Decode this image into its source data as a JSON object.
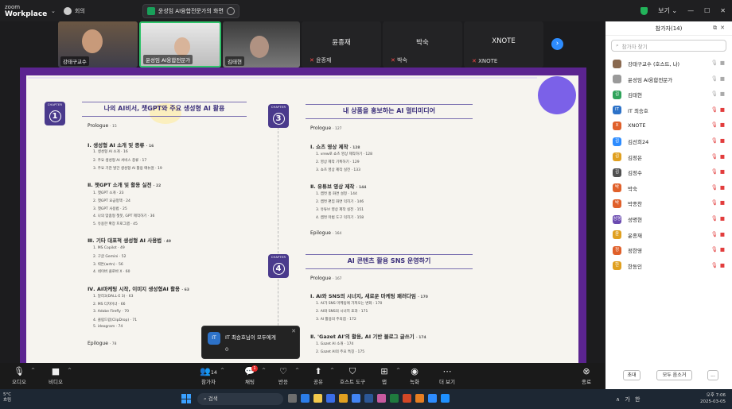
{
  "app": {
    "brand_top": "zoom",
    "brand_bottom": "Workplace",
    "meeting_label": "회의"
  },
  "sharing_banner": {
    "text": "윤성임 AI융합전문가의 화면"
  },
  "titlebar_right": {
    "view_label": "보기"
  },
  "video_strip": [
    {
      "name": "강태구교수"
    },
    {
      "name": "윤성임 AI융합전문가"
    },
    {
      "name": "김태현"
    },
    {
      "name": "윤종재",
      "label": "윤종재"
    },
    {
      "name": "박숙",
      "label": "박숙"
    },
    {
      "name": "XNOTE",
      "label": "XNOTE"
    }
  ],
  "document": {
    "chapters": [
      {
        "number": "1",
        "chapter_word": "CHAPTER",
        "title": "나의 AI비서, 챗GPT와 주요 생성형 AI 활용"
      },
      {
        "number": "3",
        "chapter_word": "CHAPTER",
        "title": "내 상품을 홍보하는 AI 멀티미디어"
      },
      {
        "number": "4",
        "chapter_word": "CHAPTER",
        "title": "AI 콘텐츠 활용 SNS 운영하기"
      }
    ],
    "left": {
      "prologue": "Prologue",
      "prologue_page": "· 15",
      "s1": "Ⅰ. 생성형 AI 소개 및 종류",
      "s1_page": "· 16",
      "s1_items": [
        "1. 생성형 AI 소개 · 16",
        "2. 주요 생성형 AI 서비스 종류 · 17",
        "3. 주요 기관 발간 생성형 AI 활용 매뉴얼 · 19"
      ],
      "s2": "Ⅱ. 챗GPT 소개 및 활용 실전",
      "s2_page": "· 22",
      "s2_items": [
        "1. 챗GPT 소개 · 23",
        "2. 챗GPT 요금정책 · 24",
        "3. 챗GPT 사용법 · 25",
        "4. 나의 맞춤형 챗봇, GPT 제작하기 · 36",
        "5. 유용한 확장 프로그램 · 45"
      ],
      "s3": "Ⅲ. 기타 대표적 생성형 AI 사용법",
      "s3_page": "· 49",
      "s3_items": [
        "1. MS Copilot · 49",
        "2. 구글 Gemini · 52",
        "3. 뤼튼(wrtn) · 56",
        "4. 네이버 클로바 X · 60"
      ],
      "s4": "Ⅳ. AI마케팅 시작, 이미지 생성형AI 활용",
      "s4_page": "· 63",
      "s4_items": [
        "1. 달리3(DALL·E 3) · 63",
        "2. MS 디자이너 · 66",
        "3. Adobe Firefly · 70",
        "4. 클립드랍(ClipDrop) · 71",
        "5. ideogram · 74"
      ],
      "epilogue": "Epilogue",
      "epilogue_page": "· 78"
    },
    "right": {
      "prologue": "Prologue",
      "prologue_page": "· 127",
      "s1": "Ⅰ. 쇼츠 영상 제작",
      "s1_page": "· 128",
      "s1_items": [
        "1. vrew로 쇼츠 영상 제작하기 · 128",
        "2. 영상 제작 기획하기 · 129",
        "3. 쇼츠 영상 제작 실전 · 133"
      ],
      "s2": "Ⅱ. 유튜브 영상 제작",
      "s2_page": "· 144",
      "s2_items": [
        "1. 캡컷 홈 화면 설정 · 144",
        "2. 캡컷 편집 화면 익히기 · 146",
        "3. 유튜브 영상 제작 실전 · 151",
        "4. 캡컷 마법 도구 익히기 · 158"
      ],
      "epilogue": "Epilogue",
      "epilogue_page": "· 164",
      "prologue2": "Prologue",
      "prologue2_page": "· 167",
      "s3": "Ⅰ. AI와 SNS의 시너지, 새로운 마케팅 패러다임",
      "s3_page": "· 170",
      "s3_items": [
        "1. AI가 SNS 마케팅에 가져오는 변화 · 170",
        "2. AI와 SNS의 시너지 효과 · 171",
        "3. AI 활용의 주의점 · 172"
      ],
      "s4": "Ⅱ. 'Gazet AI'의 활용, AI 기반 블로그 글쓰기",
      "s4_page": "· 174",
      "s4_items": [
        "1. Gazet AI 소개 · 174",
        "2. Gazet AI의 주요 특징 · 175"
      ]
    }
  },
  "toast": {
    "avatar": "IT",
    "title": "IT 최승호님이 모두에게",
    "body": "0"
  },
  "toolbar": [
    {
      "label": "오디오",
      "icon": "mic-icon"
    },
    {
      "label": "비디오",
      "icon": "video-icon"
    },
    {
      "label": "참가자",
      "icon": "participants-icon",
      "count": "14"
    },
    {
      "label": "채팅",
      "icon": "chat-icon",
      "badge": "1"
    },
    {
      "label": "반응",
      "icon": "reaction-icon"
    },
    {
      "label": "공유",
      "icon": "share-icon"
    },
    {
      "label": "호스트 도구",
      "icon": "shield-icon"
    },
    {
      "label": "앱",
      "icon": "apps-icon"
    },
    {
      "label": "녹화",
      "icon": "record-icon"
    },
    {
      "label": "더 보기",
      "icon": "more-icon"
    },
    {
      "label": "종료",
      "icon": "end-icon"
    }
  ],
  "participants": {
    "title": "참가자(14)",
    "search_placeholder": "참가자 찾기",
    "list": [
      {
        "name": "강태구교수 (호스트, 나)",
        "avatar": "",
        "color": "#8a6a50"
      },
      {
        "name": "윤성임 AI융합전문가",
        "avatar": "",
        "color": "#9a9a9a"
      },
      {
        "name": "김태현",
        "avatar": "김",
        "color": "#2fa35a"
      },
      {
        "name": "IT 최승호",
        "avatar": "IT",
        "color": "#2d72c8"
      },
      {
        "name": "XNOTE",
        "avatar": "X",
        "color": "#e0602a"
      },
      {
        "name": "김선희24",
        "avatar": "김",
        "color": "#2d8cff"
      },
      {
        "name": "김정은",
        "avatar": "김",
        "color": "#e0a020"
      },
      {
        "name": "김정수",
        "avatar": "김",
        "color": "#505050"
      },
      {
        "name": "박숙",
        "avatar": "박",
        "color": "#e0602a"
      },
      {
        "name": "박종찬",
        "avatar": "박",
        "color": "#e0602a"
      },
      {
        "name": "성명현",
        "avatar": "성명",
        "color": "#6a4ab0"
      },
      {
        "name": "윤종재",
        "avatar": "윤",
        "color": "#e0a020"
      },
      {
        "name": "정한영",
        "avatar": "정",
        "color": "#e0602a"
      },
      {
        "name": "한동인",
        "avatar": "한",
        "color": "#e0a020"
      }
    ],
    "invite_label": "초대",
    "mute_all_label": "모두 음소거",
    "more_label": "..."
  },
  "taskbar": {
    "weather_temp": "5°C",
    "weather_text": "흐림",
    "search_placeholder": "검색",
    "tray_text": "∧ 가 한",
    "time": "오후 7:06",
    "date": "2025-03-05"
  },
  "colors": {
    "accent": "#2d8cff",
    "slide_purple": "#5b2490",
    "chapter_purple": "#4a3a8c",
    "mute_red": "#e23d3d"
  }
}
